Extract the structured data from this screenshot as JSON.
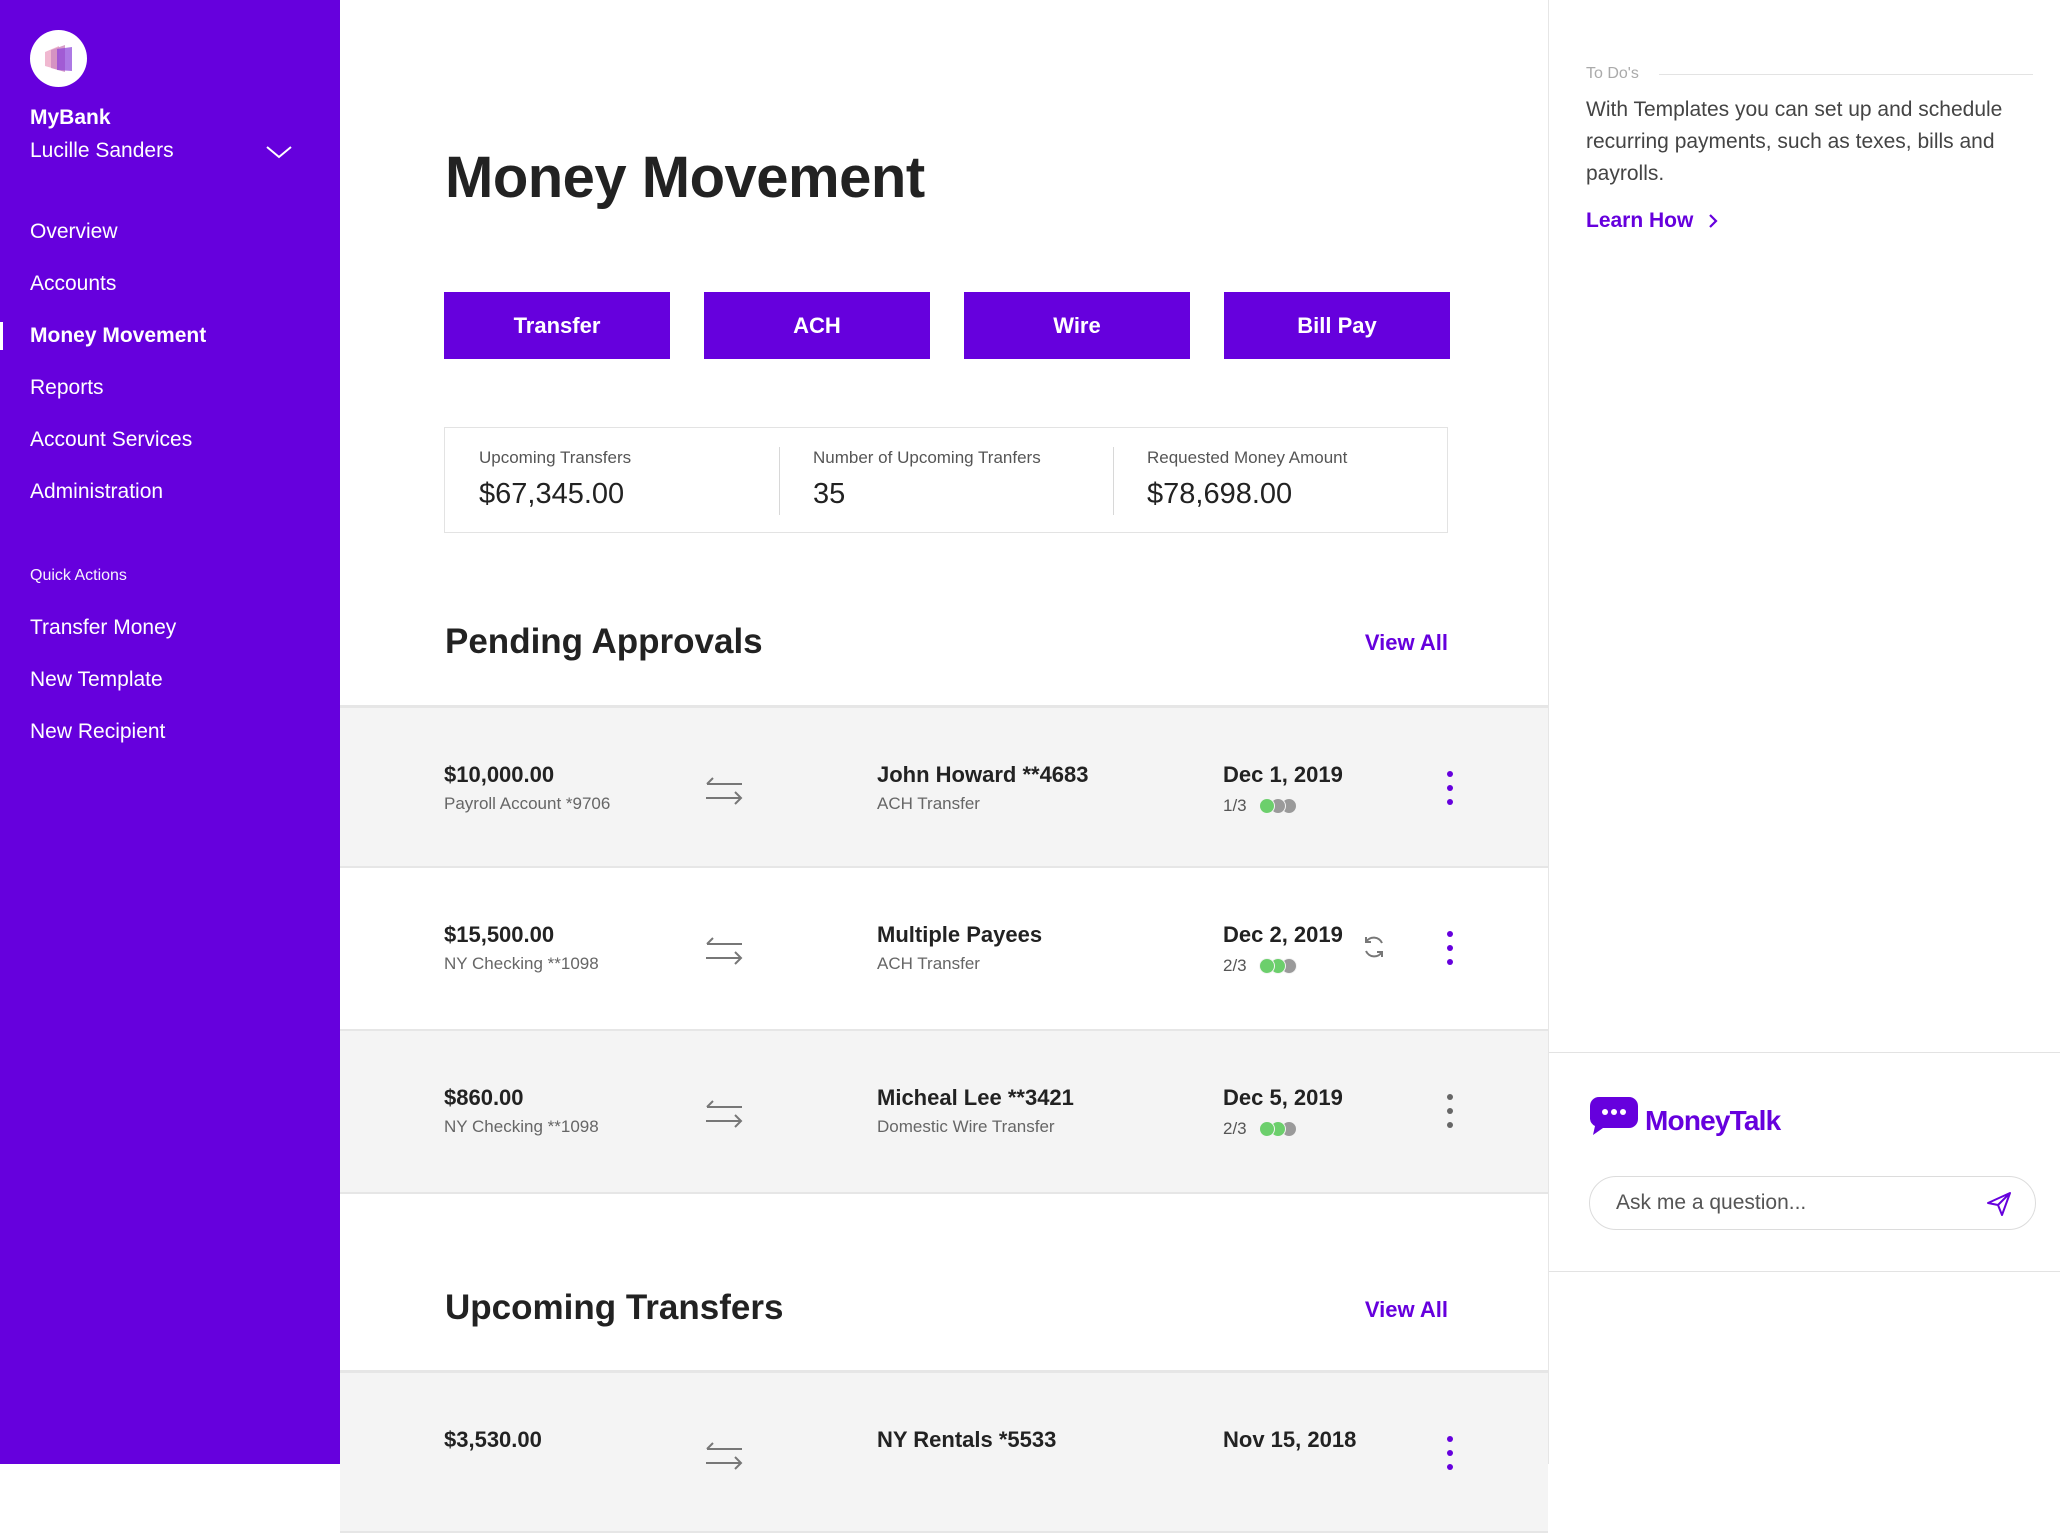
{
  "sidebar": {
    "bank_name": "MyBank",
    "user_name": "Lucille Sanders",
    "nav": [
      "Overview",
      "Accounts",
      "Money Movement",
      "Reports",
      "Account Services",
      "Administration"
    ],
    "active_nav": "Money Movement",
    "quick_actions_title": "Quick Actions",
    "quick_actions": [
      "Transfer Money",
      "New Template",
      "New Recipient"
    ]
  },
  "main": {
    "title": "Money Movement",
    "actions": [
      "Transfer",
      "ACH",
      "Wire",
      "Bill Pay"
    ],
    "summary": [
      {
        "label": "Upcoming Transfers",
        "value": "$67,345.00"
      },
      {
        "label": "Number of Upcoming Tranfers",
        "value": "35"
      },
      {
        "label": "Requested Money Amount",
        "value": "$78,698.00"
      }
    ],
    "pending": {
      "title": "Pending Approvals",
      "view_all": "View All",
      "rows": [
        {
          "amount": "$10,000.00",
          "account": "Payroll Account *9706",
          "payee": "John Howard **4683",
          "type": "ACH Transfer",
          "date": "Dec 1, 2019",
          "approvals": "1/3",
          "approved": 1,
          "recurring": false
        },
        {
          "amount": "$15,500.00",
          "account": "NY Checking **1098",
          "payee": "Multiple Payees",
          "type": "ACH Transfer",
          "date": "Dec 2, 2019",
          "approvals": "2/3",
          "approved": 2,
          "recurring": true
        },
        {
          "amount": "$860.00",
          "account": "NY Checking **1098",
          "payee": "Micheal Lee **3421",
          "type": "Domestic Wire Transfer",
          "date": "Dec 5, 2019",
          "approvals": "2/3",
          "approved": 2,
          "recurring": false
        }
      ]
    },
    "upcoming": {
      "title": "Upcoming Transfers",
      "view_all": "View All",
      "rows": [
        {
          "amount": "$3,530.00",
          "account": "",
          "payee": "NY Rentals *5533",
          "type": "",
          "date": "Nov 15, 2018",
          "approvals": "",
          "approved": 0,
          "recurring": false
        }
      ]
    }
  },
  "right": {
    "todo_label": "To Do's",
    "todo_text": "With Templates you can set up and schedule recurring payments, such as texes, bills and payrolls.",
    "learn_how": "Learn How",
    "moneytalk": {
      "name": "MoneyTalk",
      "placeholder": "Ask me a question..."
    }
  },
  "colors": {
    "brand": "#6600dd",
    "approved": "#6ccf6c",
    "pending": "#9a9a9a"
  }
}
